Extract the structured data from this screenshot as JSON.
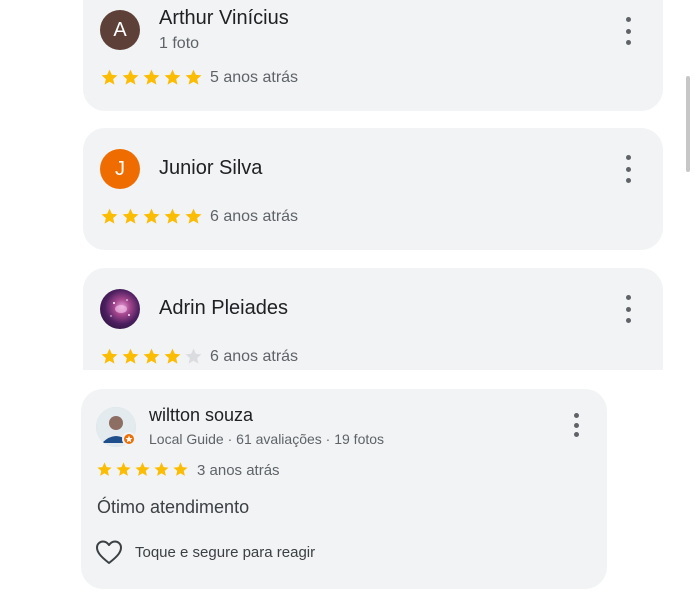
{
  "reviews": [
    {
      "initial": "A",
      "avatar_color": "#5d4037",
      "name": "Arthur Vinícius",
      "meta": "1 foto",
      "rating": 5,
      "time": "5 anos atrás"
    },
    {
      "initial": "J",
      "avatar_color": "#ef6c00",
      "name": "Junior Silva",
      "rating": 5,
      "time": "6 anos atrás"
    },
    {
      "avatar_icon": "nebula-photo-avatar",
      "name": "Adrin Pleiades",
      "rating": 4,
      "time": "6 anos atrás"
    },
    {
      "avatar_icon": "person-photo-avatar",
      "badge_icon": "local-guide-badge-icon",
      "name": "wiltton souza",
      "meta": "Local Guide · 61 avaliações · 19 fotos",
      "rating": 5,
      "time": "3 anos atrás",
      "text": "Ótimo atendimento",
      "reaction_label": "Toque e segure para reagir",
      "reaction_icon": "heart-outline-icon"
    }
  ],
  "colors": {
    "star_filled": "#fbbc04",
    "star_empty": "#dadce0",
    "card_bg": "#f1f3f4",
    "guide_badge": "#e8710a"
  }
}
